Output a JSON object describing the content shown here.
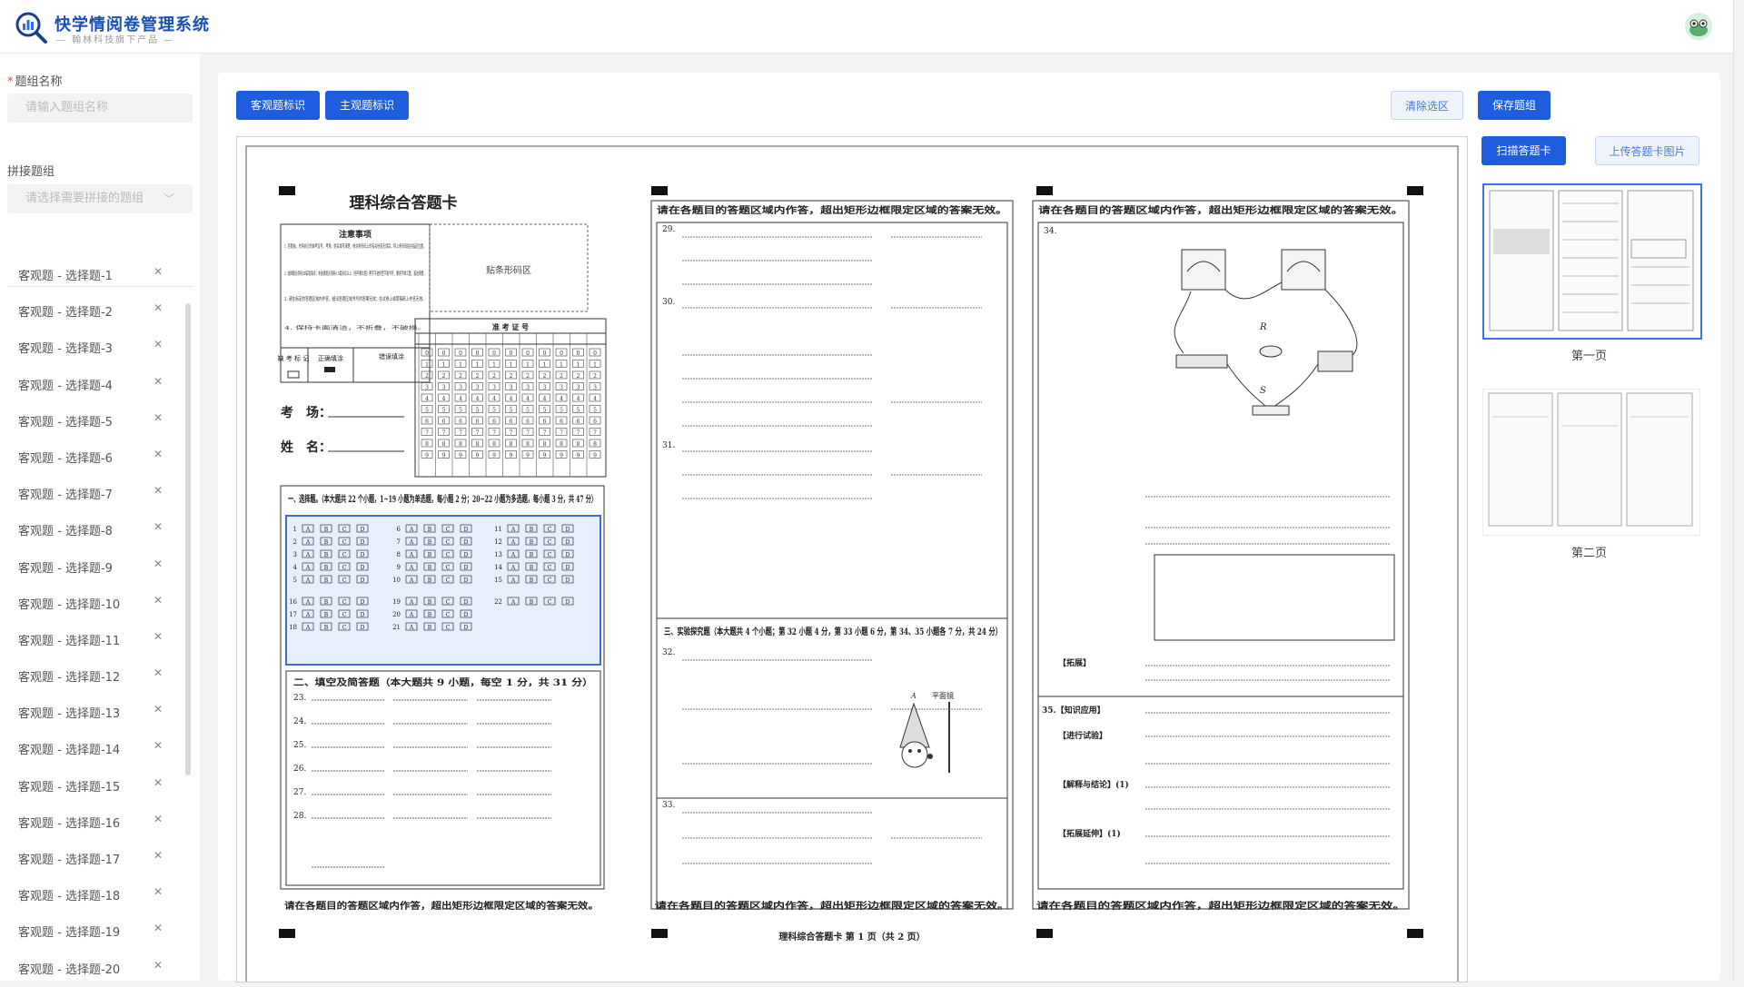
{
  "app": {
    "title": "快学情阅卷管理系统",
    "subtitle": "— 翰林科技旗下产品 —"
  },
  "sidebar": {
    "group_name_label": "题组名称",
    "group_name_placeholder": "请输入题组名称",
    "merge_label": "拼接题组",
    "merge_placeholder": "请选择需要拼接的题组",
    "items": [
      "客观题 - 选择题-1",
      "客观题 - 选择题-2",
      "客观题 - 选择题-3",
      "客观题 - 选择题-4",
      "客观题 - 选择题-5",
      "客观题 - 选择题-6",
      "客观题 - 选择题-7",
      "客观题 - 选择题-8",
      "客观题 - 选择题-9",
      "客观题 - 选择题-10",
      "客观题 - 选择题-11",
      "客观题 - 选择题-12",
      "客观题 - 选择题-13",
      "客观题 - 选择题-14",
      "客观题 - 选择题-15",
      "客观题 - 选择题-16",
      "客观题 - 选择题-17",
      "客观题 - 选择题-18",
      "客观题 - 选择题-19",
      "客观题 - 选择题-20"
    ]
  },
  "toolbar": {
    "objective": "客观题标识",
    "subjective": "主观题标识",
    "clear": "清除选区",
    "save": "保存题组"
  },
  "right_panel": {
    "scan": "扫描答题卡",
    "upload": "上传答题卡图片",
    "page1": "第一页",
    "page2": "第二页"
  },
  "sheet": {
    "title": "理科综合答题卡",
    "notice_title": "注意事项",
    "notice_text": [
      "1. 答题前，先将自己的准考证号、考场、姓名填写清楚，核对条形码上的有关信息无误后，将上条形码贴在指定位置。",
      "2. 选择题必须用2B铅笔填涂；非选择题必须用0.5毫米及以上（但不要太粗）黑字字迹的签字笔书写，要求字体工整、笔迹清楚。",
      "3. 请在标定的答题区域内作答，超出答题区域书写的答案无效；在试卷上或草稿纸上作答无效。",
      "4. 保持卡面清洁，不折叠，不破损。"
    ],
    "absent_label": "缺 考 标 记",
    "correct_label": "正确填涂",
    "wrong_label": "错误填涂",
    "barcode": "贴条形码区",
    "exam_no": "准 考 证 号",
    "exam_room": "考　场：",
    "name": "姓　名：",
    "section1_title": "一、选择题。（本大题共 22 个小题，1~19 小题为单选题，每小题 2 分；20~22 小题为多选题，每小题 3 分，共 47 分）",
    "section2_title": "二、填空及简答题（本大题共 9 小题，每空 1 分，共 31 分）",
    "section3_title": "三、实验探究题（本大题共 4 个小题；第 32 小题 4 分，第 33 小题 6 分，第 34、35 小题各 7 分，共 24 分）",
    "col_header": "请在各题目的答题区域内作答，超出矩形边框限定区域的答案无效。",
    "footer": "理科综合答题卡  第 1 页（共 2 页）",
    "expand": "【拓展】",
    "q35": "35.【知识应用】",
    "experiment": "【进行试验】",
    "conclusion": "【解释与结论】(1)",
    "extension": "【拓展延伸】(1)",
    "mirror": "平面镜",
    "letter_a": "A"
  }
}
